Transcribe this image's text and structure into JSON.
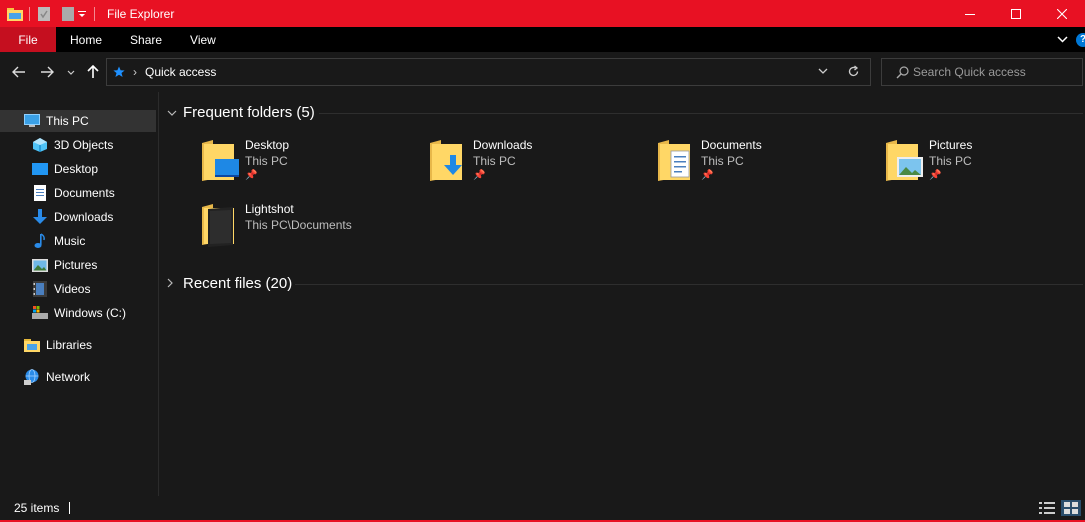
{
  "window": {
    "title": "File Explorer",
    "accent": "#e81123"
  },
  "ribbon": {
    "tabs": [
      "File",
      "Home",
      "Share",
      "View"
    ],
    "help": "?"
  },
  "address": {
    "path": "Quick access"
  },
  "search": {
    "placeholder": "Search Quick access"
  },
  "sidebar": {
    "items": [
      {
        "label": "This PC",
        "icon": "this-pc-icon"
      },
      {
        "label": "3D Objects",
        "icon": "3d-objects-icon"
      },
      {
        "label": "Desktop",
        "icon": "desktop-icon"
      },
      {
        "label": "Documents",
        "icon": "documents-icon"
      },
      {
        "label": "Downloads",
        "icon": "downloads-icon"
      },
      {
        "label": "Music",
        "icon": "music-icon"
      },
      {
        "label": "Pictures",
        "icon": "pictures-icon"
      },
      {
        "label": "Videos",
        "icon": "videos-icon"
      },
      {
        "label": "Windows (C:)",
        "icon": "drive-icon"
      },
      {
        "label": "Libraries",
        "icon": "libraries-icon"
      },
      {
        "label": "Network",
        "icon": "network-icon"
      }
    ]
  },
  "main": {
    "frequent_header": "Frequent folders (5)",
    "recent_header": "Recent files (20)",
    "folders": [
      {
        "name": "Desktop",
        "location": "This PC",
        "pinned": true,
        "icon": "desktop-folder-icon"
      },
      {
        "name": "Downloads",
        "location": "This PC",
        "pinned": true,
        "icon": "downloads-folder-icon"
      },
      {
        "name": "Documents",
        "location": "This PC",
        "pinned": true,
        "icon": "documents-folder-icon"
      },
      {
        "name": "Pictures",
        "location": "This PC",
        "pinned": true,
        "icon": "pictures-folder-icon"
      },
      {
        "name": "Lightshot",
        "location": "This PC\\Documents",
        "pinned": false,
        "icon": "lightshot-folder-icon"
      }
    ]
  },
  "status": {
    "count": "25 items"
  }
}
